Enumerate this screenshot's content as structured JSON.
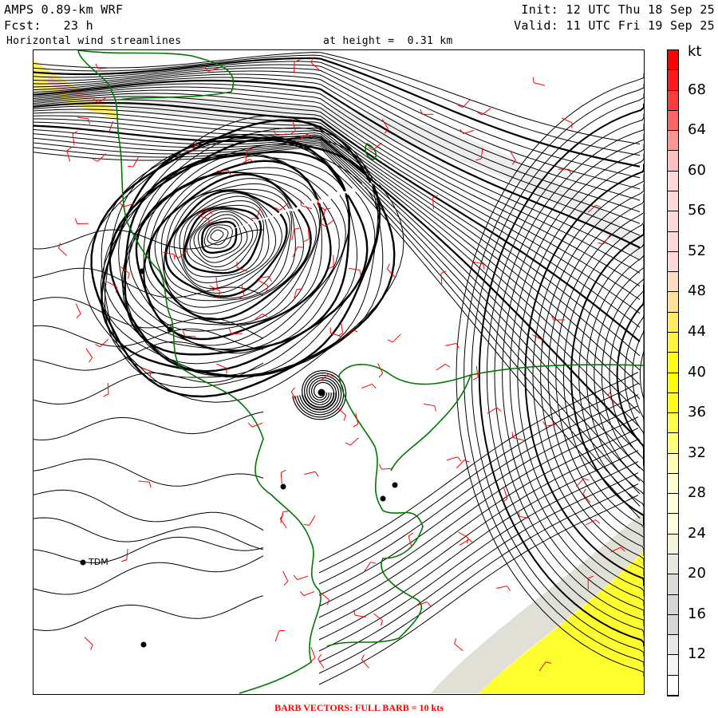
{
  "header": {
    "model": "AMPS 0.89-km WRF",
    "forecast": "Fcst:   23 h",
    "init": "Init: 12 UTC Thu 18 Sep 25",
    "valid": "Valid: 11 UTC Fri 19 Sep 25",
    "field": "Horizontal wind streamlines",
    "level": "at height =  0.31 km"
  },
  "colorbar": {
    "unit": "kt",
    "labels": [
      "68",
      "64",
      "60",
      "56",
      "52",
      "48",
      "44",
      "40",
      "36",
      "32",
      "28",
      "24",
      "20",
      "16",
      "12"
    ],
    "colors_top_to_bottom": [
      "#ff0000",
      "#ff1a1a",
      "#ff3c3c",
      "#ff6464",
      "#ff9696",
      "#ffc0c0",
      "#ffd8d8",
      "#ffd8d8",
      "#ffd8d8",
      "#ffd8d8",
      "#ffd8d8",
      "#ffdcc4",
      "#ffe298",
      "#ffec60",
      "#fff43c",
      "#ffff14",
      "#ffff00",
      "#ffff14",
      "#ffff46",
      "#ffff7c",
      "#ffffb4",
      "#ffffd2",
      "#ffffdc",
      "#ffffdc",
      "#f4f4dc",
      "#e8e8dc",
      "#dcdcd8",
      "#d6d6d6",
      "#d6d6d6",
      "#e8e8e8",
      "#f4f4f4",
      "#ffffff"
    ]
  },
  "stations": [
    {
      "label": "TDM"
    }
  ],
  "footer": "BARB VECTORS:  FULL BARB = 10 kts",
  "colors": {
    "streamline": "#000000",
    "coastline": "#007800",
    "barb": "#ff0000"
  }
}
